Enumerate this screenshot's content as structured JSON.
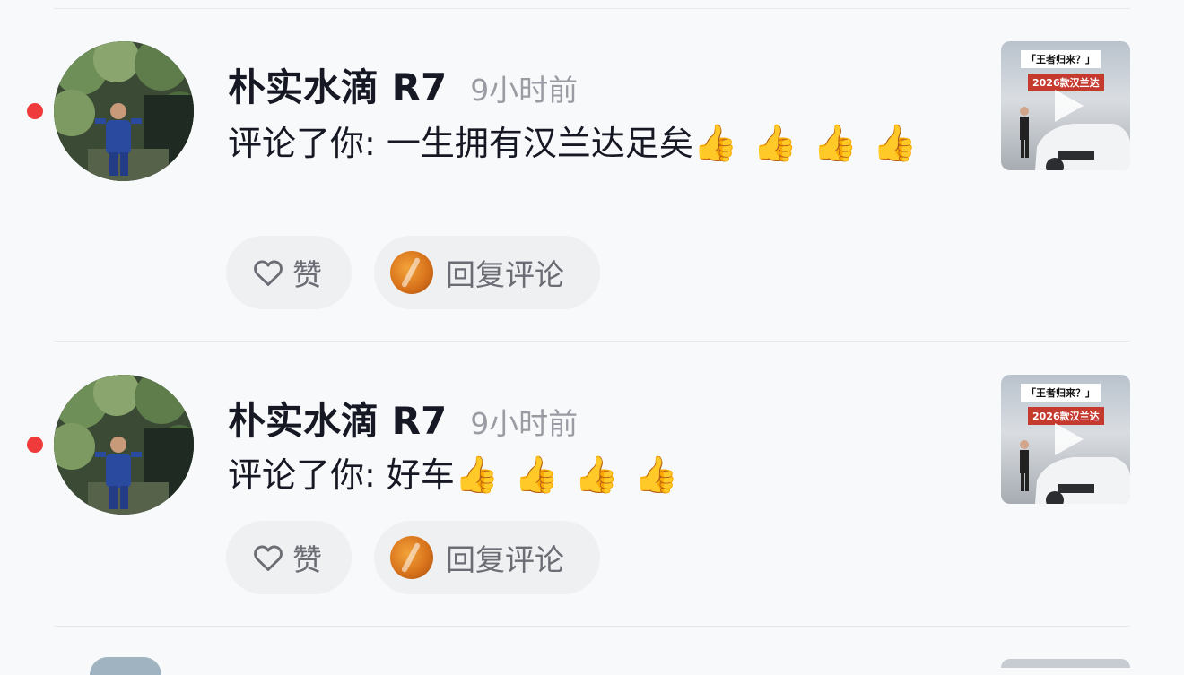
{
  "colors": {
    "background": "#f8f9fb",
    "unread_dot": "#ef3b3b",
    "pill_background": "#eff0f2",
    "text_primary": "#161823",
    "text_secondary": "#9a9ca4"
  },
  "notifications": [
    {
      "username": "朴实水滴 R7",
      "time": "9小时前",
      "comment_prefix": "评论了你: ",
      "comment_body": "一生拥有汉兰达足矣",
      "thumbs": "👍 👍 👍 👍",
      "like_label": "赞",
      "reply_label": "回复评论",
      "video_title": "「王者归来？」",
      "video_subtitle": "2026款汉兰达",
      "unread": true
    },
    {
      "username": "朴实水滴 R7",
      "time": "9小时前",
      "comment_prefix": "评论了你: ",
      "comment_body": "好车",
      "thumbs": "👍 👍 👍 👍",
      "like_label": "赞",
      "reply_label": "回复评论",
      "video_title": "「王者归来？」",
      "video_subtitle": "2026款汉兰达",
      "unread": true
    }
  ],
  "icons": {
    "like": "heart-outline-icon",
    "play": "play-icon",
    "unread": "unread-dot-icon"
  }
}
